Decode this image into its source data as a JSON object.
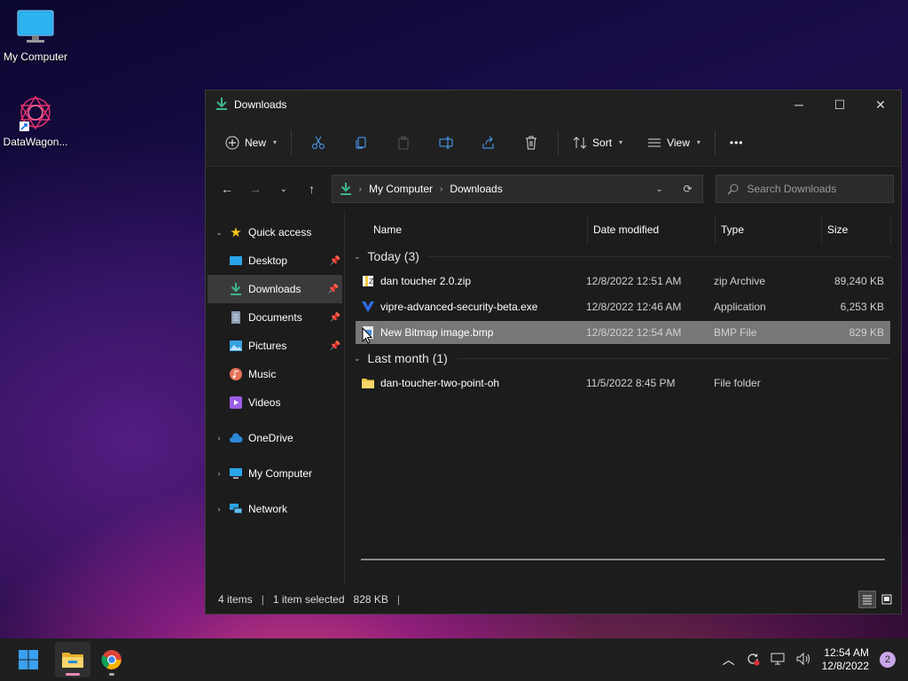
{
  "desktop": {
    "icons": [
      {
        "label": "My Computer"
      },
      {
        "label": "DataWagon..."
      }
    ]
  },
  "window": {
    "title": "Downloads",
    "controls": {
      "minimize": "─",
      "maximize": "☐",
      "close": "✕"
    }
  },
  "toolbar": {
    "new_label": "New",
    "sort_label": "Sort",
    "view_label": "View",
    "more_label": "•••"
  },
  "address": {
    "crumbs": [
      "My Computer",
      "Downloads"
    ],
    "search_placeholder": "Search Downloads"
  },
  "nav": {
    "quick_access": "Quick access",
    "items": [
      {
        "label": "Desktop",
        "pinned": true
      },
      {
        "label": "Downloads",
        "pinned": true
      },
      {
        "label": "Documents",
        "pinned": true
      },
      {
        "label": "Pictures",
        "pinned": true
      },
      {
        "label": "Music",
        "pinned": false
      },
      {
        "label": "Videos",
        "pinned": false
      }
    ],
    "roots": [
      {
        "label": "OneDrive"
      },
      {
        "label": "My Computer"
      },
      {
        "label": "Network"
      }
    ]
  },
  "columns": {
    "name": "Name",
    "date": "Date modified",
    "type": "Type",
    "size": "Size"
  },
  "groups": [
    {
      "label": "Today (3)",
      "files": [
        {
          "name": "dan toucher 2.0.zip",
          "date": "12/8/2022 12:51 AM",
          "type": "zip Archive",
          "size": "89,240 KB",
          "icon": "zip-icon"
        },
        {
          "name": "vipre-advanced-security-beta.exe",
          "date": "12/8/2022 12:46 AM",
          "type": "Application",
          "size": "6,253 KB",
          "icon": "vipre-app-icon"
        },
        {
          "name": "New Bitmap image.bmp",
          "date": "12/8/2022 12:54 AM",
          "type": "BMP File",
          "size": "829 KB",
          "icon": "bitmap-file-icon",
          "selected": true
        }
      ]
    },
    {
      "label": "Last month (1)",
      "files": [
        {
          "name": "dan-toucher-two-point-oh",
          "date": "11/5/2022 8:45 PM",
          "type": "File folder",
          "size": "",
          "icon": "folder-icon"
        }
      ]
    }
  ],
  "status": {
    "count": "4 items",
    "selection": "1 item selected",
    "selection_size": "828 KB"
  },
  "taskbar": {
    "time": "12:54 AM",
    "date": "12/8/2022",
    "notifications": "2"
  },
  "colors": {
    "accent_green": "#3fb68b",
    "selection": "#777777",
    "window_bg": "#1c1c1c"
  }
}
